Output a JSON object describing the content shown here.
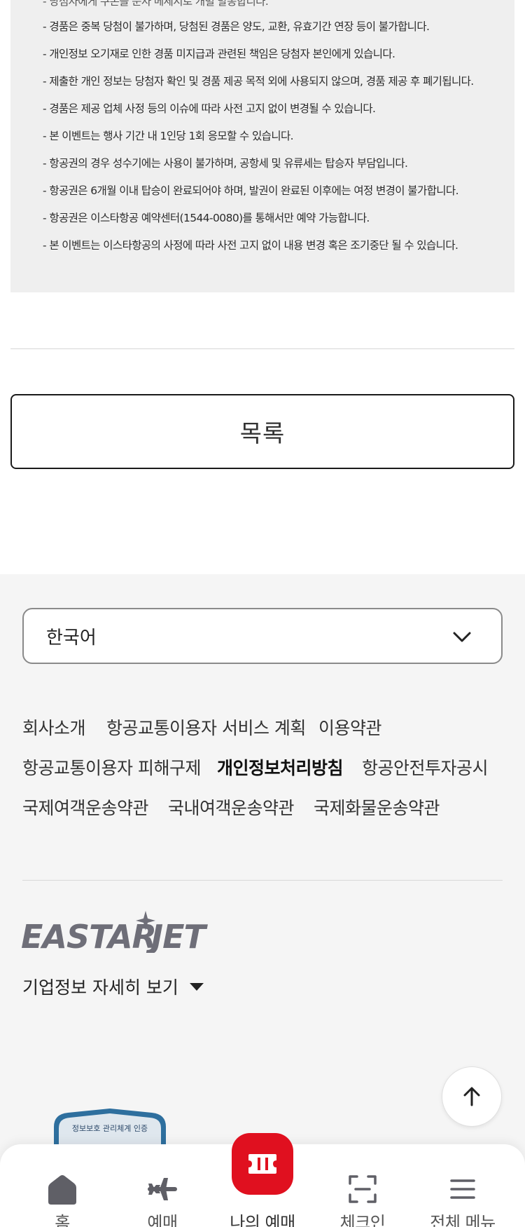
{
  "notice": {
    "items": [
      "- 경품은 중복 당첨이 불가하며, 당첨된 경품은 양도, 교환, 유효기간 연장 등이 불가합니다.",
      "- 개인정보 오기재로 인한 경품 미지급과 관련된 책임은 당첨자 본인에게 있습니다.",
      "- 제출한 개인 정보는 당첨자 확인 및 경품 제공 목적 외에 사용되지 않으며, 경품 제공 후 폐기됩니다.",
      "- 경품은 제공 업체 사정 등의 이슈에 따라 사전 고지 없이 변경될 수 있습니다.",
      "- 본 이벤트는 행사 기간 내 1인당 1회 응모할 수 있습니다.",
      "- 항공권의 경우 성수기에는 사용이 불가하며, 공항세 및 유류세는 탑승자 부담입니다.",
      "- 항공권은 6개월 이내 탑승이 완료되어야 하며, 발권이 완료된 이후에는 여정 변경이 불가합니다.",
      "- 항공권은 이스타항공 예약센터(1544-0080)를 통해서만 예약 가능합니다.",
      "- 본 이벤트는 이스타항공의 사정에 따라 사전 고지 없이 내용 변경 혹은 조기중단 될 수 있습니다."
    ]
  },
  "list_button": {
    "label": "목록"
  },
  "footer": {
    "language": {
      "selected": "한국어"
    },
    "links": [
      "회사소개",
      "항공교통이용자 서비스 계획",
      "이용약관",
      "항공교통이용자 피해구제",
      "개인정보처리방침",
      "항공안전투자공시",
      "국제여객운송약관",
      "국내여객운송약관",
      "국제화물운송약관"
    ],
    "logo_text": "EASTAR JET",
    "company_info_toggle": "기업정보 자세히 보기",
    "cert_badge_text": "정보보호 관리체계 인증"
  },
  "bottom_nav": {
    "items": [
      {
        "label": "홈",
        "icon": "home-icon"
      },
      {
        "label": "예매",
        "icon": "airplane-icon"
      },
      {
        "label": "나의 예매",
        "icon": "ticket-icon"
      },
      {
        "label": "체크인",
        "icon": "scan-icon"
      },
      {
        "label": "전체 메뉴",
        "icon": "menu-icon"
      }
    ]
  },
  "colors": {
    "brand_red": "#e0101f",
    "footer_bg": "#f5f5f5",
    "notice_bg": "#efefef",
    "logo_gray": "#6e6e78"
  }
}
